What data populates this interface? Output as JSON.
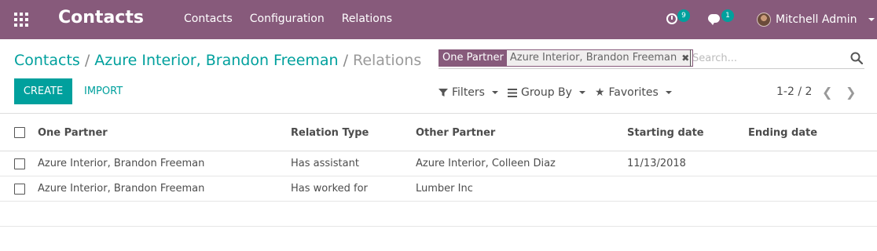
{
  "topbar": {
    "app_title": "Contacts",
    "menu": [
      "Contacts",
      "Configuration",
      "Relations"
    ],
    "activity_count": "9",
    "message_count": "1",
    "user_name": "Mitchell Admin",
    "color": "#875a7b"
  },
  "breadcrumb": {
    "items": [
      "Contacts",
      "Azure Interior, Brandon Freeman"
    ],
    "separator": "/",
    "current": "Relations"
  },
  "search": {
    "facet_label": "One Partner",
    "facet_value": "Azure Interior, Brandon Freeman",
    "placeholder": "Search..."
  },
  "buttons": {
    "create": "CREATE",
    "import": "IMPORT"
  },
  "search_options": {
    "filters": "Filters",
    "group_by": "Group By",
    "favorites": "Favorites"
  },
  "pager": {
    "value": "1-2 / 2"
  },
  "table": {
    "columns": [
      "One Partner",
      "Relation Type",
      "Other Partner",
      "Starting date",
      "Ending date"
    ],
    "rows": [
      [
        "Azure Interior, Brandon Freeman",
        "Has assistant",
        "Azure Interior, Colleen Diaz",
        "11/13/2018",
        ""
      ],
      [
        "Azure Interior, Brandon Freeman",
        "Has worked for",
        "Lumber Inc",
        "",
        ""
      ]
    ]
  },
  "accent_color": "#00a09d"
}
